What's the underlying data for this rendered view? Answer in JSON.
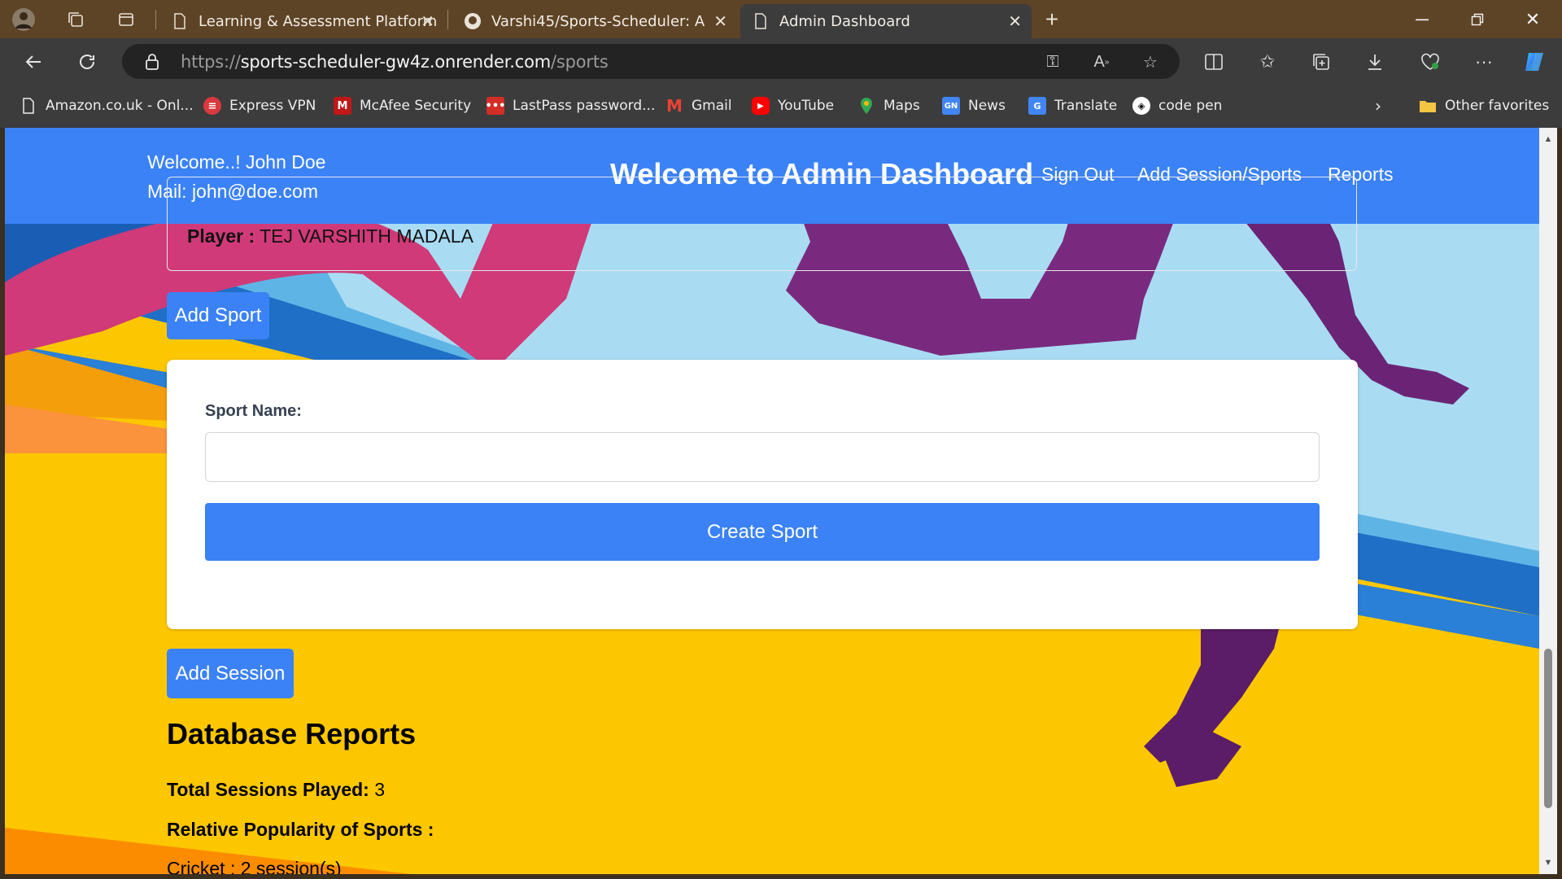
{
  "browser": {
    "tabs": [
      {
        "title": "Learning & Assessment Platform",
        "active": false
      },
      {
        "title": "Varshi45/Sports-Scheduler: A Spo",
        "active": false
      },
      {
        "title": "Admin Dashboard",
        "active": true
      }
    ],
    "url_scheme": "https://",
    "url_host": "sports-scheduler-gw4z.onrender.com",
    "url_path": "/sports",
    "bookmarks": [
      {
        "label": "Amazon.co.uk - Onl...",
        "icon": "page-icon"
      },
      {
        "label": "Express VPN",
        "icon": "expressvpn-icon"
      },
      {
        "label": "McAfee Security",
        "icon": "mcafee-icon"
      },
      {
        "label": "LastPass password...",
        "icon": "lastpass-icon"
      },
      {
        "label": "Gmail",
        "icon": "gmail-icon"
      },
      {
        "label": "YouTube",
        "icon": "youtube-icon"
      },
      {
        "label": "Maps",
        "icon": "maps-icon"
      },
      {
        "label": "News",
        "icon": "news-icon"
      },
      {
        "label": "Translate",
        "icon": "translate-icon"
      },
      {
        "label": "code pen",
        "icon": "codepen-icon"
      }
    ],
    "other_favorites": "Other favorites"
  },
  "header": {
    "welcome": "Welcome..! John Doe",
    "mail": "Mail: john@doe.com",
    "title": "Welcome to Admin Dashboard",
    "nav": [
      "Sign Out",
      "Add Session/Sports",
      "Reports"
    ]
  },
  "player": {
    "label": "Player :",
    "name": "TEJ VARSHITH MADALA"
  },
  "add_sport_button": "Add Sport",
  "sport_form": {
    "label": "Sport Name:",
    "value": "",
    "submit": "Create Sport"
  },
  "add_session_button": "Add Session",
  "reports": {
    "title": "Database Reports",
    "total_label": "Total Sessions Played:",
    "total_value": "3",
    "popularity_label": "Relative Popularity of Sports :",
    "sports": [
      "Cricket : 2 session(s)"
    ]
  },
  "colors": {
    "primary": "#3b82f6",
    "tabbar": "#5e4426",
    "toolbar": "#3c3c3c"
  }
}
